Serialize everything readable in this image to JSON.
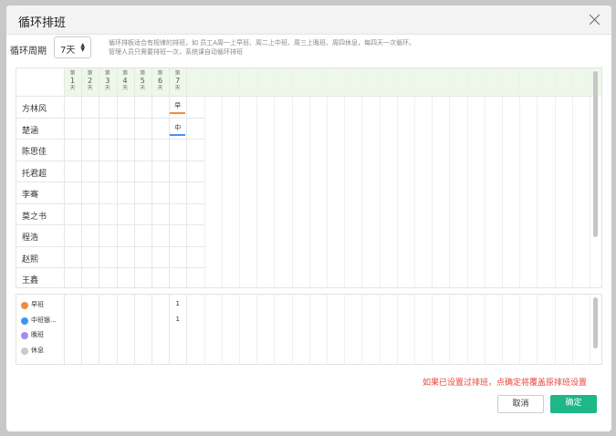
{
  "dialog": {
    "title": "循环排班",
    "close_icon": "close-icon"
  },
  "cycle": {
    "label": "循环周期",
    "value": "7天",
    "arrow_icon": "updown-arrow-icon"
  },
  "description": {
    "line1": "循环排板适合有规律的排班，如 员工A周一上早班、周二上中班、周三上晚班、周四休息，每四天一次循环。",
    "line2": "管理人员只需要排班一次，系统课自动循环排班"
  },
  "days": [
    {
      "pre": "第",
      "num": "1",
      "post": "天"
    },
    {
      "pre": "第",
      "num": "2",
      "post": "天"
    },
    {
      "pre": "第",
      "num": "3",
      "post": "天"
    },
    {
      "pre": "第",
      "num": "4",
      "post": "天"
    },
    {
      "pre": "第",
      "num": "5",
      "post": "天"
    },
    {
      "pre": "第",
      "num": "6",
      "post": "天"
    },
    {
      "pre": "第",
      "num": "7",
      "post": "天"
    }
  ],
  "employees": [
    {
      "name": "方林风",
      "shift_day7": "早"
    },
    {
      "name": "楚涵",
      "shift_day7": "中"
    },
    {
      "name": "陈思佳"
    },
    {
      "name": "托君超"
    },
    {
      "name": "李骞"
    },
    {
      "name": "莫之书"
    },
    {
      "name": "程浩"
    },
    {
      "name": "赵熙"
    },
    {
      "name": "王鑫"
    }
  ],
  "legend": [
    {
      "label": "早班",
      "color": "#f28c3c",
      "day7": "1"
    },
    {
      "label": "中班银...",
      "color": "#3d97f0",
      "day7": "1"
    },
    {
      "label": "晚班",
      "color": "#a98af0",
      "day7": ""
    },
    {
      "label": "休息",
      "color": "#c9c9c9",
      "day7": ""
    }
  ],
  "colors": {
    "early": "#f28c3c",
    "mid": "#3d97f0",
    "accent": "#1eb787",
    "warning": "#e8453c"
  },
  "footer": {
    "warning": "如果已设置过排班，点确定将覆盖原排班设置",
    "cancel": "取消",
    "confirm": "确定"
  }
}
